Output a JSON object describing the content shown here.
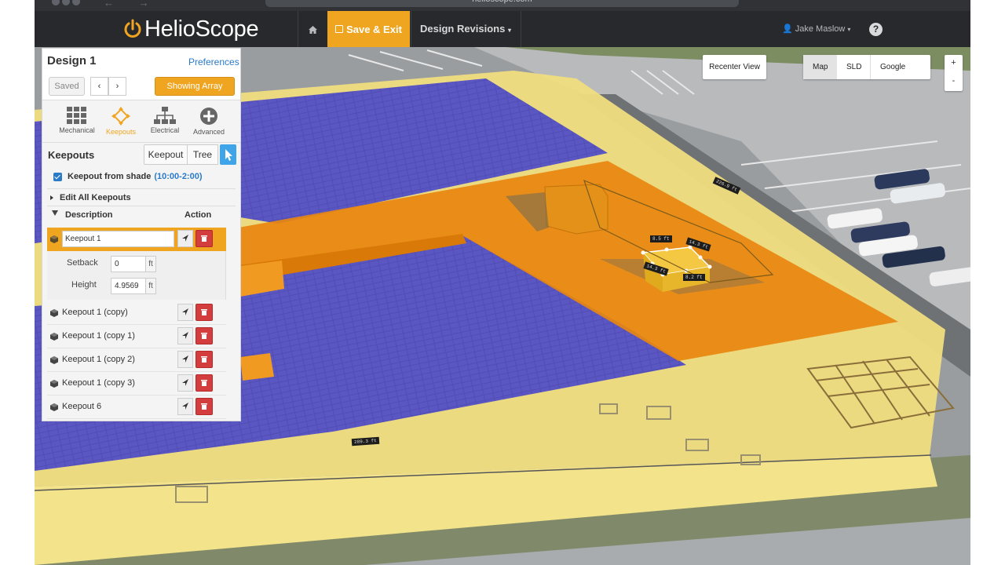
{
  "browser": {
    "url": "helioscope.com"
  },
  "topbar": {
    "logo_text": "HelioScope",
    "save_exit_label": "Save & Exit",
    "design_revisions_label": "Design Revisions",
    "user_name": "Jake Maslow",
    "help_label": "?"
  },
  "map_controls": {
    "recenter_label": "Recenter View",
    "map_label": "Map",
    "sld_label": "SLD",
    "google_label": "Google",
    "zoom_in": "+",
    "zoom_out": "-"
  },
  "panel": {
    "title": "Design 1",
    "preferences_label": "Preferences",
    "saved_label": "Saved",
    "prev_label": "‹",
    "next_label": "›",
    "showing_array_label": "Showing Array",
    "tabs": [
      {
        "label": "Mechanical",
        "icon": "grid-icon"
      },
      {
        "label": "Keepouts",
        "icon": "keepout-move-icon"
      },
      {
        "label": "Electrical",
        "icon": "hierarchy-icon"
      },
      {
        "label": "Advanced",
        "icon": "plus-circle-icon"
      }
    ],
    "keepouts": {
      "title": "Keepouts",
      "keepout_btn": "Keepout",
      "tree_btn": "Tree",
      "shade_label": "Keepout from shade",
      "shade_time": "(10:00-2:00)",
      "edit_all_label": "Edit All Keepouts",
      "col_description": "Description",
      "col_action": "Action",
      "active": {
        "name": "Keepout 1",
        "setback_label": "Setback",
        "setback_value": "0",
        "height_label": "Height",
        "height_value": "4.9569",
        "unit": "ft"
      },
      "rows": [
        {
          "label": "Keepout 1 (copy)"
        },
        {
          "label": "Keepout 1 (copy 1)"
        },
        {
          "label": "Keepout 1 (copy 2)"
        },
        {
          "label": "Keepout 1 (copy 3)"
        },
        {
          "label": "Keepout 6"
        }
      ]
    }
  },
  "map": {
    "dimension_labels": [
      "226.9 ft",
      "289.3 ft",
      "8.5 ft",
      "14.3 ft",
      "14.3 ft",
      "8.2 ft"
    ]
  },
  "colors": {
    "accent": "#f0a520",
    "topbar": "#28292c",
    "link": "#2a7ac8",
    "delete": "#d33d3d",
    "roof_fill": "#f3e27a",
    "keepout_fill": "#e88a12",
    "panel_fill": "#5550b8"
  }
}
